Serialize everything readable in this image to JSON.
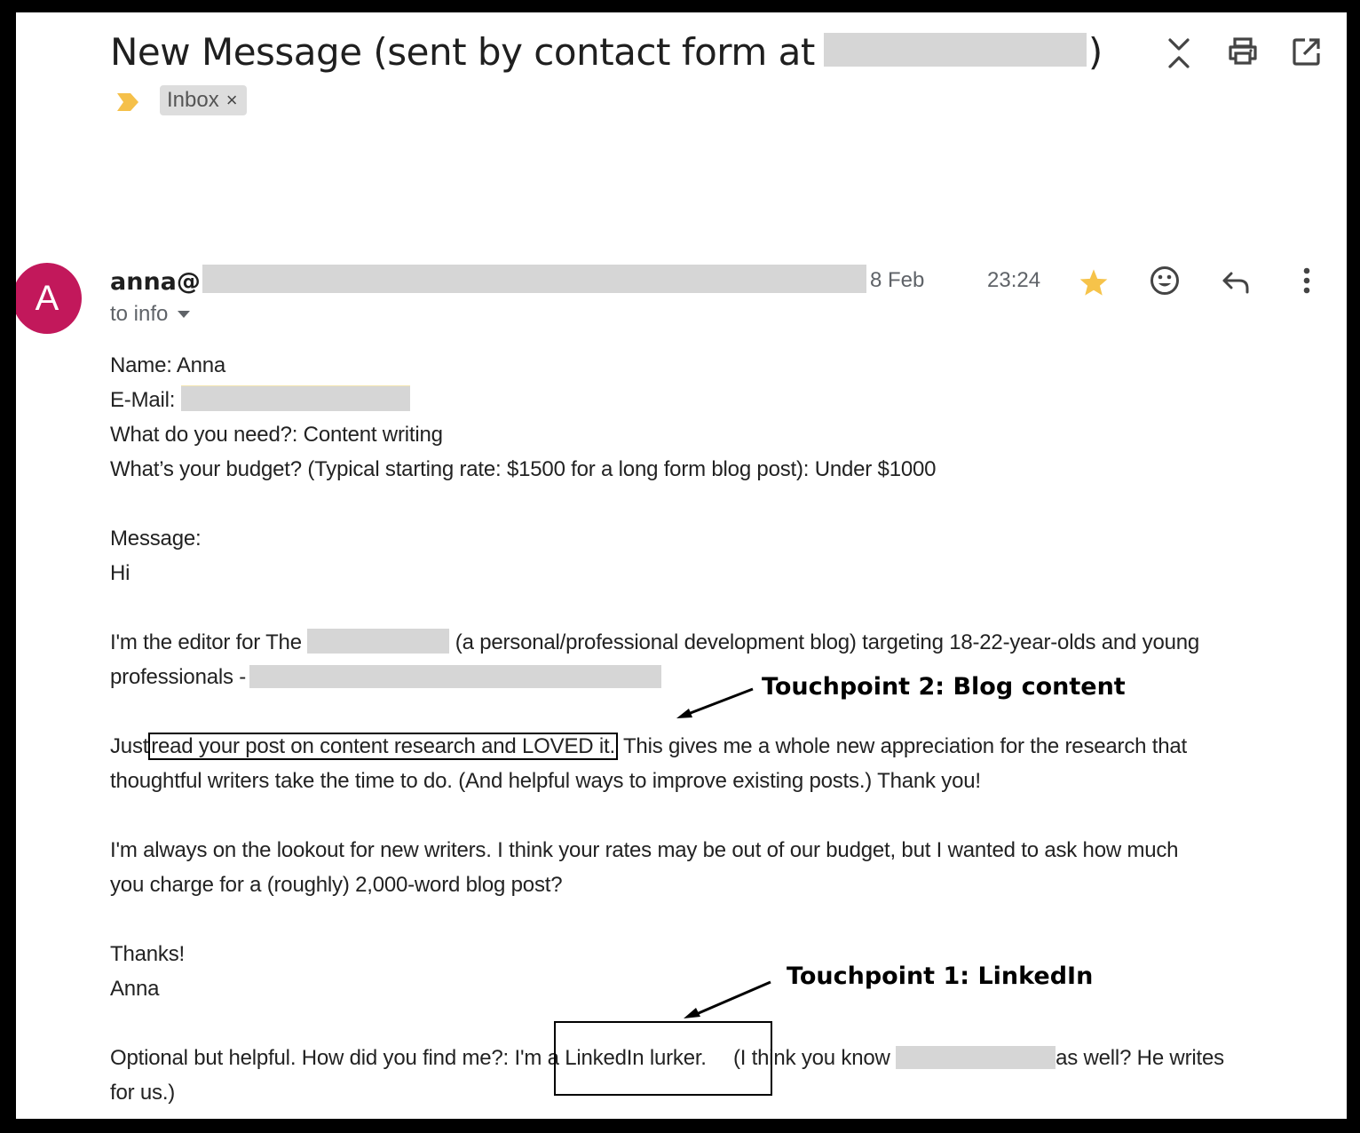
{
  "header": {
    "subject_prefix": "New Message (sent by contact form at",
    "subject_suffix": ")",
    "label_chip": "Inbox",
    "label_remove": "×",
    "toolbar": {
      "collapse_icon": "unfold-less-icon",
      "print_icon": "print-icon",
      "open_new_window_icon": "open-in-new-icon"
    }
  },
  "message": {
    "avatar_letter": "A",
    "avatar_color": "#c2185b",
    "sender_prefix": "anna@",
    "recipient": "to info",
    "date": "8 Feb",
    "time": "23:24",
    "star_color": "#f6c34a",
    "starred": true,
    "actions": [
      "emoji-reaction-icon",
      "reply-icon",
      "more-options-icon"
    ]
  },
  "body": {
    "fields": {
      "name": "Name: Anna",
      "email_label": "E-Mail:",
      "need": "What do you need?: Content writing",
      "budget": "What’s your budget? (Typical starting rate: $1500 for a long form blog post): Under $1000"
    },
    "message_label": "Message:",
    "greeting": "Hi",
    "p1_a": "I'm the editor for The",
    "p1_b": "(a personal/professional development blog) targeting 18-22-year-olds and young",
    "p1_c": "professionals -",
    "p2_a": "Just",
    "p2_highlight": "read your post on content research and LOVED it.",
    "p2_b": "This gives me a whole new appreciation for the research that",
    "p2_c": "thoughtful writers take the time to do. (And helpful ways to improve existing posts.) Thank you!",
    "p3_a": "I'm always on the lookout for new writers. I think your rates may be out of our budget, but I wanted to ask how much",
    "p3_b": "you charge for a (roughly) 2,000-word blog post?",
    "signoff": "Thanks!",
    "signature": "Anna",
    "p4_a": "Optional but helpful. How did you find me?:",
    "p4_highlight": "I'm a LinkedIn lurker.",
    "p4_b": "(I think you know",
    "p4_c": "as well? He writes",
    "p4_d": "for us.)"
  },
  "annotations": {
    "touchpoint_2": "Touchpoint 2: Blog content",
    "touchpoint_1": "Touchpoint 1: LinkedIn"
  }
}
